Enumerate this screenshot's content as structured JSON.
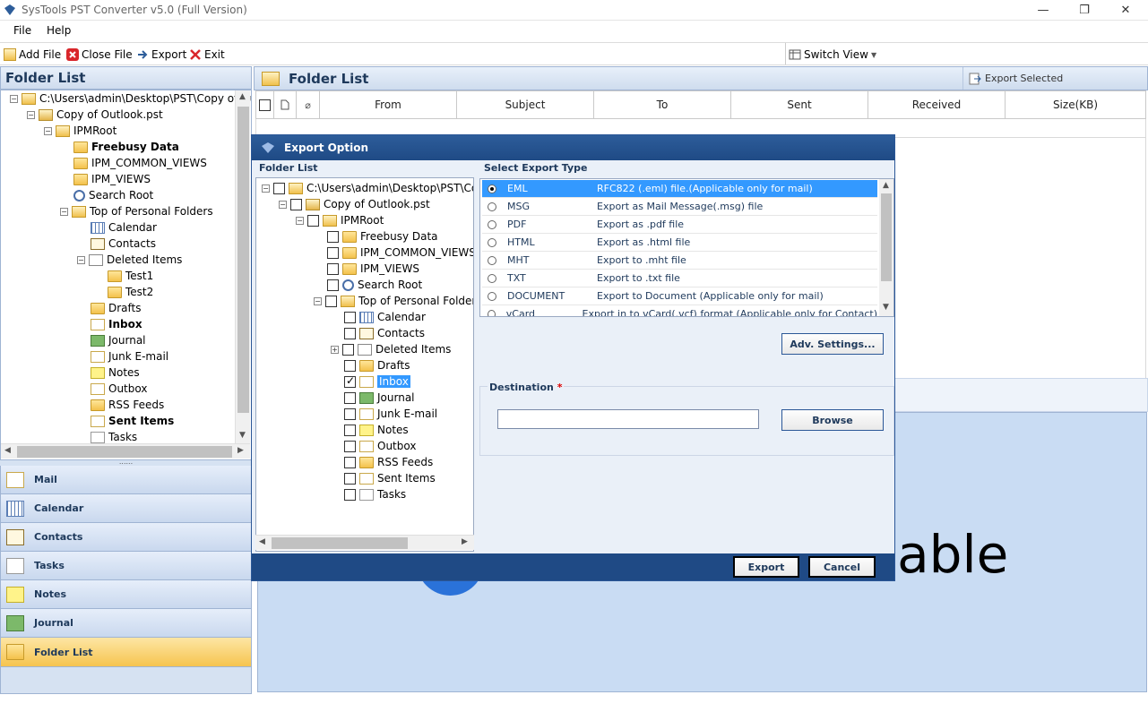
{
  "window": {
    "title": "SysTools  PST Converter v5.0 (Full Version)",
    "controls": [
      "—",
      "❐",
      "✕"
    ]
  },
  "menu": [
    "File",
    "Help"
  ],
  "toolbar": {
    "add_file": "Add File",
    "close_file": "Close File",
    "export": "Export",
    "exit": "Exit",
    "switch_view": "Switch View"
  },
  "left": {
    "header": "Folder List",
    "tree": [
      {
        "label": "C:\\Users\\admin\\Desktop\\PST\\Copy of Ou"
      },
      {
        "label": "Copy of Outlook.pst"
      },
      {
        "label": "IPMRoot"
      },
      {
        "label": "Freebusy Data"
      },
      {
        "label": "IPM_COMMON_VIEWS"
      },
      {
        "label": "IPM_VIEWS"
      },
      {
        "label": "Search Root"
      },
      {
        "label": "Top of Personal Folders"
      },
      {
        "label": "Calendar"
      },
      {
        "label": "Contacts"
      },
      {
        "label": "Deleted Items"
      },
      {
        "label": "Test1"
      },
      {
        "label": "Test2"
      },
      {
        "label": "Drafts"
      },
      {
        "label": "Inbox"
      },
      {
        "label": "Journal"
      },
      {
        "label": "Junk E-mail"
      },
      {
        "label": "Notes"
      },
      {
        "label": "Outbox"
      },
      {
        "label": "RSS Feeds"
      },
      {
        "label": "Sent Items"
      },
      {
        "label": "Tasks"
      }
    ],
    "splitter": "......"
  },
  "nav": [
    "Mail",
    "Calendar",
    "Contacts",
    "Tasks",
    "Notes",
    "Journal",
    "Folder List"
  ],
  "right": {
    "header": "Folder List",
    "export_selected": "Export Selected",
    "columns": [
      "From",
      "Subject",
      "To",
      "Sent",
      "Received",
      "Size(KB)"
    ],
    "preview_text": "lable"
  },
  "dialog": {
    "title": "Export Option",
    "folder_list_label": "Folder List",
    "tree": [
      {
        "label": "C:\\Users\\admin\\Desktop\\PST\\Copy"
      },
      {
        "label": "Copy of Outlook.pst"
      },
      {
        "label": "IPMRoot"
      },
      {
        "label": "Freebusy Data"
      },
      {
        "label": "IPM_COMMON_VIEWS"
      },
      {
        "label": "IPM_VIEWS"
      },
      {
        "label": "Search Root"
      },
      {
        "label": "Top of Personal Folders"
      },
      {
        "label": "Calendar"
      },
      {
        "label": "Contacts"
      },
      {
        "label": "Deleted Items"
      },
      {
        "label": "Drafts"
      },
      {
        "label": "Inbox"
      },
      {
        "label": "Journal"
      },
      {
        "label": "Junk E-mail"
      },
      {
        "label": "Notes"
      },
      {
        "label": "Outbox"
      },
      {
        "label": "RSS Feeds"
      },
      {
        "label": "Sent Items"
      },
      {
        "label": "Tasks"
      }
    ],
    "export_type_label": "Select Export Type",
    "types": [
      {
        "name": "EML",
        "desc": "RFC822 (.eml) file.(Applicable only for mail)"
      },
      {
        "name": "MSG",
        "desc": "Export as Mail Message(.msg) file"
      },
      {
        "name": "PDF",
        "desc": "Export as .pdf file"
      },
      {
        "name": "HTML",
        "desc": "Export as .html file"
      },
      {
        "name": "MHT",
        "desc": "Export to .mht file"
      },
      {
        "name": "TXT",
        "desc": "Export to .txt file"
      },
      {
        "name": "DOCUMENT",
        "desc": "Export to Document (Applicable only for mail)"
      },
      {
        "name": "vCard",
        "desc": "Export in to vCard(.vcf) format (Applicable only for Contact)"
      }
    ],
    "adv_settings": "Adv. Settings...",
    "destination_label": "Destination",
    "destination_required": "*",
    "destination_value": "",
    "browse": "Browse",
    "export": "Export",
    "cancel": "Cancel"
  },
  "colors": {
    "accent": "#1e395b",
    "selection": "#3399ff",
    "dialog_title": "#1f4a85",
    "active_nav": "#f6c44f"
  }
}
